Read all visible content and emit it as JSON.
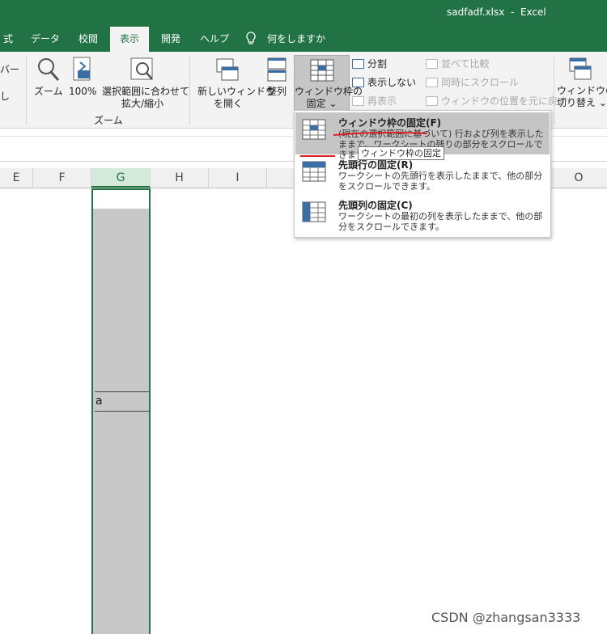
{
  "window": {
    "title": "sadfadf.xlsx  -  Excel"
  },
  "tabs": [
    {
      "label": "式"
    },
    {
      "label": "データ"
    },
    {
      "label": "校閲"
    },
    {
      "label": "表示"
    },
    {
      "label": "開発"
    },
    {
      "label": "ヘルプ"
    },
    {
      "label": "何をしますか"
    }
  ],
  "ribbon": {
    "left_partial_1": "バー",
    "left_partial_2": "し",
    "zoom": "ズーム",
    "zoom100": "100%",
    "fit_selection_line1": "選択範囲に合わせて",
    "fit_selection_line2": "拡大/縮小",
    "zoom_group": "ズーム",
    "new_window_line1": "新しいウィンドウ",
    "new_window_line2": "を開く",
    "arrange": "整列",
    "freeze_line1": "ウィンドウ枠の",
    "freeze_line2": "固定 ⌄",
    "split": "分割",
    "hide": "表示しない",
    "unhide": "再表示",
    "side_by_side": "並べて比較",
    "sync_scroll": "同時にスクロール",
    "reset_position": "ウィンドウの位置を元に戻す",
    "switch_line1": "ウィンドウの",
    "switch_line2": "切り替え ⌄"
  },
  "columns": [
    "E",
    "F",
    "G",
    "H",
    "I",
    "O"
  ],
  "cell": {
    "value": "a"
  },
  "dropdown": {
    "items": [
      {
        "title": "ウィンドウ枠の固定(F)",
        "desc": "(現在の選択範囲に基づいて) 行および列を表示したままで、ワークシートの残りの部分をスクロールできます。"
      },
      {
        "title": "先頭行の固定(R)",
        "desc": "ワークシートの先頭行を表示したままで、他の部分をスクロールできます。"
      },
      {
        "title": "先頭列の固定(C)",
        "desc": "ワークシートの最初の列を表示したままで、他の部分をスクロールできます。"
      }
    ],
    "tooltip": "ウィンドウ枠の固定"
  },
  "watermark": "CSDN @zhangsan3333",
  "colors": {
    "excel_green": "#217346",
    "annotation_red": "#e02020"
  }
}
